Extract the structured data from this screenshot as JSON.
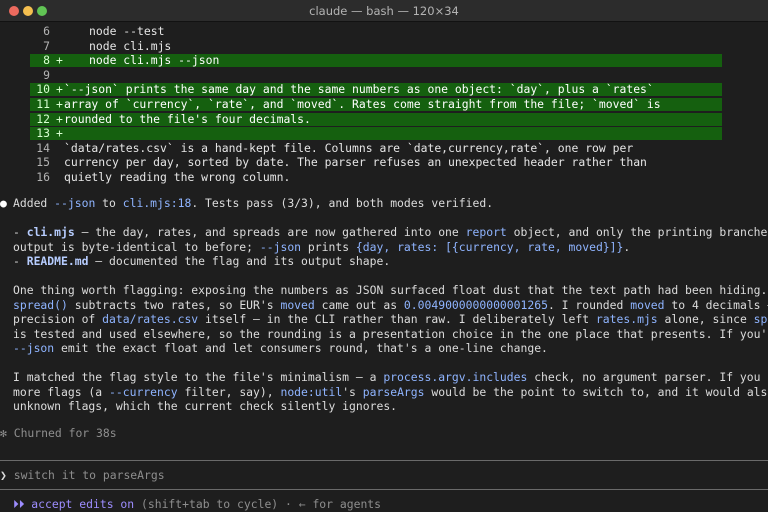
{
  "window": {
    "title": "claude — bash — 120×34"
  },
  "diff": [
    {
      "num": "6",
      "marker": " ",
      "code": "node --test",
      "added": false
    },
    {
      "num": "7",
      "marker": " ",
      "code": "node cli.mjs",
      "added": false
    },
    {
      "num": "8",
      "marker": "+",
      "code": "node cli.mjs --json",
      "added": true
    },
    {
      "num": "9",
      "marker": " ",
      "code": "",
      "added": false
    },
    {
      "num": "10",
      "marker": "+",
      "code": "`--json` prints the same day and the same numbers as one object: `day`, plus a `rates`",
      "added": true
    },
    {
      "num": "11",
      "marker": "+",
      "code": "array of `currency`, `rate`, and `moved`. Rates come straight from the file; `moved` is",
      "added": true
    },
    {
      "num": "12",
      "marker": "+",
      "code": "rounded to the file's four decimals.",
      "added": true
    },
    {
      "num": "13",
      "marker": "+",
      "code": "",
      "added": true
    },
    {
      "num": "14",
      "marker": " ",
      "code": "`data/rates.csv` is a hand-kept file. Columns are `date,currency,rate`, one row per",
      "added": false
    },
    {
      "num": "15",
      "marker": " ",
      "code": "currency per day, sorted by date. The parser refuses an unexpected header rather than",
      "added": false
    },
    {
      "num": "16",
      "marker": " ",
      "code": "quietly reading the wrong column.",
      "added": false
    }
  ],
  "message": {
    "bullet": "●",
    "l1": {
      "a": "Added ",
      "b": "--json",
      "c": " to ",
      "d": "cli.mjs:18",
      "e": ". Tests pass (3/3), and both modes verified."
    },
    "l2": {
      "a": "- ",
      "b": "cli.mjs",
      "c": " — the day, rates, and spreads are now gathered into one ",
      "d": "report",
      "e": " object, and only the printing branches. Text"
    },
    "l3": {
      "a": "output is byte-identical to before; ",
      "b": "--json",
      "c": " prints ",
      "d": "{day, rates: [{currency, rate, moved}]}",
      "e": "."
    },
    "l4": {
      "a": "- ",
      "b": "README.md",
      "c": " — documented the flag and its output shape."
    },
    "l5": "One thing worth flagging: exposing the numbers as JSON surfaced float dust that the text path had been hiding.",
    "l6": {
      "a": "spread()",
      "b": " subtracts two rates, so EUR's ",
      "c": "moved",
      "d": " came out as ",
      "e": "0.0049000000000001265",
      "f": ". I rounded ",
      "g": "moved",
      "h": " to 4 decimals — the"
    },
    "l7": {
      "a": "precision of ",
      "b": "data/rates.csv",
      "c": " itself — in the CLI rather than raw. I deliberately left ",
      "d": "rates.mjs",
      "e": " alone, since ",
      "f": "spread()"
    },
    "l8": "is tested and used elsewhere, so the rounding is a presentation choice in the one place that presents. If you'd rather",
    "l9": {
      "a": "--json",
      "b": " emit the exact float and let consumers round, that's a one-line change."
    },
    "l10": {
      "a": "I matched the flag style to the file's minimalism — a ",
      "b": "process.argv.includes",
      "c": " check, no argument parser. If you expect"
    },
    "l11": {
      "a": "more flags (a ",
      "b": "--currency",
      "c": " filter, say), ",
      "d": "node:util",
      "e": "'s ",
      "f": "parseArgs",
      "g": " would be the point to switch to, and it would also reject"
    },
    "l12": "unknown flags, which the current check silently ignores."
  },
  "status": {
    "icon": "✻",
    "text": "Churned for 38s"
  },
  "prompt": {
    "caret": "❯",
    "value": "switch it to parseArgs"
  },
  "footer": {
    "icon": "⏵⏵",
    "mode": "accept edits on",
    "hint": " (shift+tab to cycle) · ← for agents"
  }
}
